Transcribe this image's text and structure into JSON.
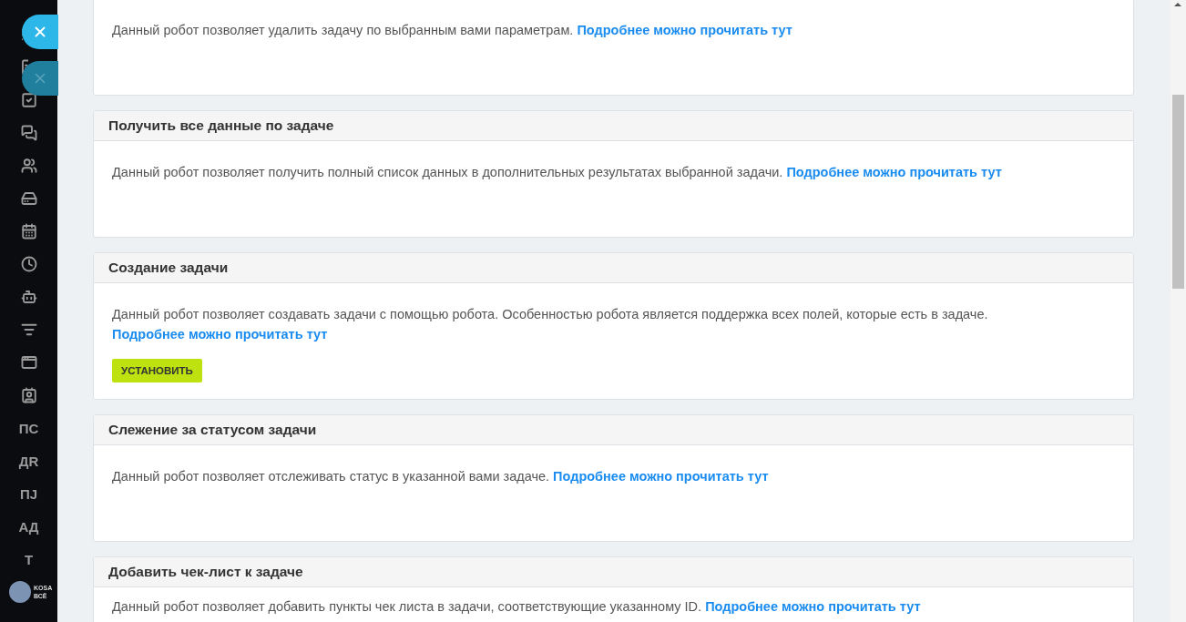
{
  "sidebar": {
    "items": [
      {
        "kind": "icon"
      },
      {
        "kind": "icon"
      },
      {
        "kind": "icon"
      },
      {
        "kind": "icon"
      },
      {
        "kind": "icon"
      },
      {
        "kind": "icon"
      },
      {
        "kind": "icon"
      },
      {
        "kind": "icon"
      },
      {
        "kind": "icon"
      },
      {
        "kind": "icon"
      },
      {
        "kind": "icon"
      },
      {
        "kind": "icon"
      },
      {
        "kind": "text",
        "label": "ПС"
      },
      {
        "kind": "text",
        "label": "ДR"
      },
      {
        "kind": "text",
        "label": "ПJ"
      },
      {
        "kind": "text",
        "label": "АД"
      },
      {
        "kind": "text",
        "label": "Т"
      }
    ],
    "logo": {
      "line_1": "KOSA",
      "line_2": "ВСЁ"
    }
  },
  "cards": [
    {
      "text": "Данный робот позволяет удалить задачу по выбранным вами параметрам. ",
      "link": "Подробнее можно прочитать тут"
    },
    {
      "title": "Получить все данные по задаче",
      "text": "Данный робот позволяет получить полный список данных в дополнительных результатах выбранной задачи. ",
      "link": "Подробнее можно прочитать тут"
    },
    {
      "title": "Создание задачи",
      "text": "Данный робот позволяет создавать задачи с помощью робота. Особенностью робота является поддержка всех полей, которые есть в задаче. ",
      "link": "Подробнее можно прочитать тут",
      "button": "УСТАНОВИТЬ"
    },
    {
      "title": "Слежение за статусом задачи",
      "text": "Данный робот позволяет отслеживать статус в указанной вами задаче. ",
      "link": "Подробнее можно прочитать тут"
    },
    {
      "title": "Добавить чек-лист к задаче",
      "text": "Данный робот позволяет добавить пункты чек листа в задачи, соответствующие указанному ID. ",
      "link": "Подробнее можно прочитать тут"
    }
  ]
}
